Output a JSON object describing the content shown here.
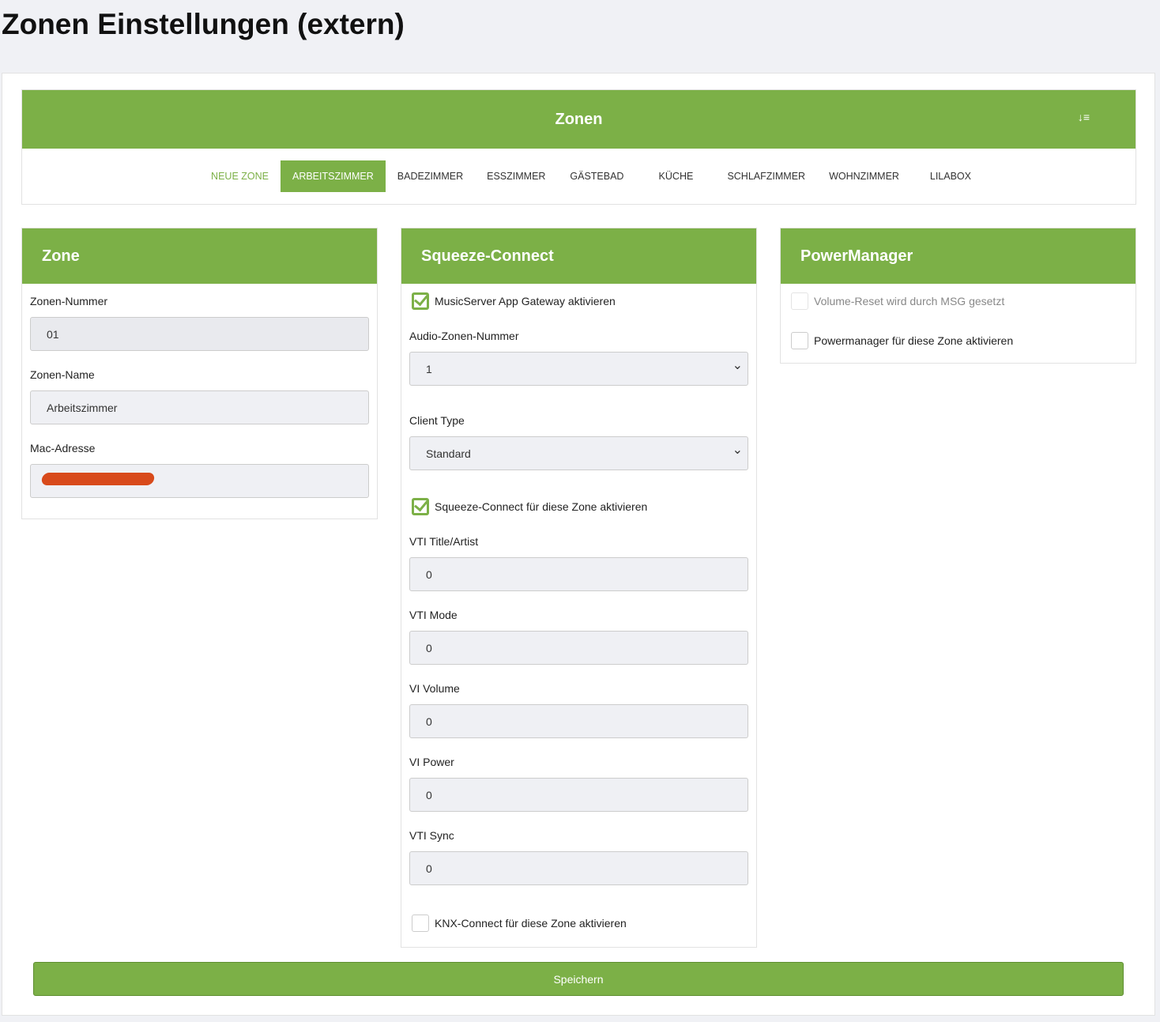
{
  "title": "Zonen Einstellungen (extern)",
  "zonen": {
    "header": "Zonen",
    "sort_icon": "sort-icon",
    "tabs": [
      "Neue Zone",
      "Arbeitszimmer",
      "Badezimmer",
      "Esszimmer",
      "Gästebad",
      "Küche",
      "Schlafzimmer",
      "Wohnzimmer",
      "LilaBox"
    ],
    "active": "Arbeitszimmer"
  },
  "zone": {
    "header": "Zone",
    "nummer_label": "Zonen-Nummer",
    "nummer": "01",
    "name_label": "Zonen-Name",
    "name": "Arbeitszimmer",
    "mac_label": "Mac-Adresse"
  },
  "squeeze": {
    "header": "Squeeze-Connect",
    "gateway_label": "MusicServer App Gateway aktivieren",
    "gateway_checked": true,
    "audio_label": "Audio-Zonen-Nummer",
    "audio_value": "1",
    "client_label": "Client Type",
    "client_value": "Standard",
    "enable_label": "Squeeze-Connect für diese Zone aktivieren",
    "enable_checked": true,
    "vti_title_label": "VTI Title/Artist",
    "vti_title": "0",
    "vti_mode_label": "VTI Mode",
    "vti_mode": "0",
    "vi_volume_label": "VI Volume",
    "vi_volume": "0",
    "vi_power_label": "VI Power",
    "vi_power": "0",
    "vti_sync_label": "VTI Sync",
    "vti_sync": "0",
    "knx_label": "KNX-Connect für diese Zone aktivieren",
    "knx_checked": false
  },
  "power": {
    "header": "PowerManager",
    "reset_label": "Volume-Reset wird durch MSG gesetzt",
    "enable_label": "Powermanager für diese Zone aktivieren"
  },
  "save_label": "Speichern",
  "colors": {
    "accent": "#7cb047"
  }
}
